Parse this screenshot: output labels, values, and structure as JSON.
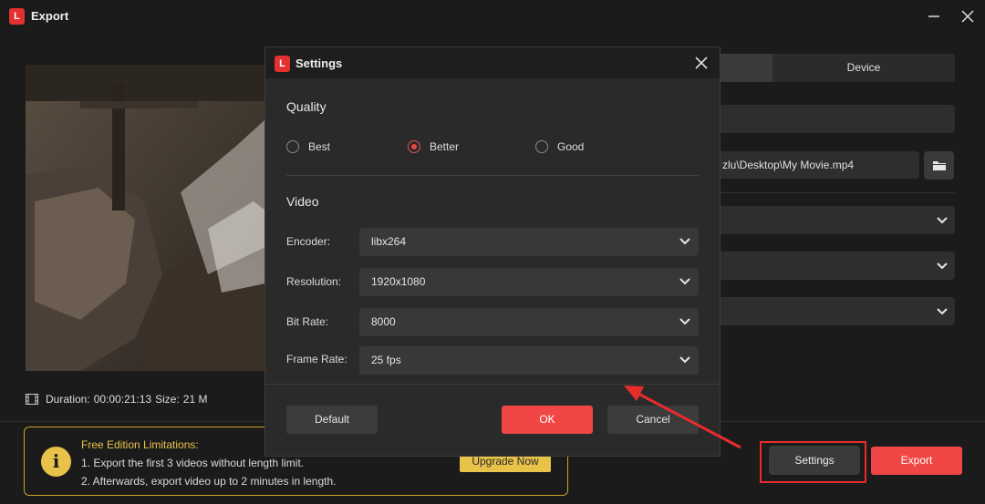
{
  "window": {
    "title": "Export",
    "logo_letter": "L"
  },
  "video_info": {
    "duration_label": "Duration:",
    "duration": "00:00:21:13",
    "size_label": "Size:",
    "size": "21 M"
  },
  "export_panel": {
    "tab_device": "Device",
    "save_path": "zlu\\Desktop\\My Movie.mp4"
  },
  "limitations": {
    "title": "Free Edition Limitations:",
    "line1": "1. Export the first 3 videos without length limit.",
    "line2": "2. Afterwards, export video up to 2 minutes in length.",
    "upgrade_label": "Upgrade Now",
    "info_glyph": "i"
  },
  "footer": {
    "settings_label": "Settings",
    "export_label": "Export"
  },
  "dialog": {
    "title": "Settings",
    "logo_letter": "L",
    "quality": {
      "title": "Quality",
      "options": [
        "Best",
        "Better",
        "Good"
      ],
      "selected": "Better"
    },
    "video": {
      "title": "Video",
      "encoder_label": "Encoder:",
      "encoder_value": "libx264",
      "resolution_label": "Resolution:",
      "resolution_value": "1920x1080",
      "bitrate_label": "Bit Rate:",
      "bitrate_value": "8000",
      "framerate_label": "Frame Rate:",
      "framerate_value": "25 fps"
    },
    "default_label": "Default",
    "ok_label": "OK",
    "cancel_label": "Cancel"
  },
  "colors": {
    "accent": "#f04646",
    "highlight": "#e82c2c",
    "warning": "#e9c24a",
    "bg": "#1b1b1b"
  }
}
